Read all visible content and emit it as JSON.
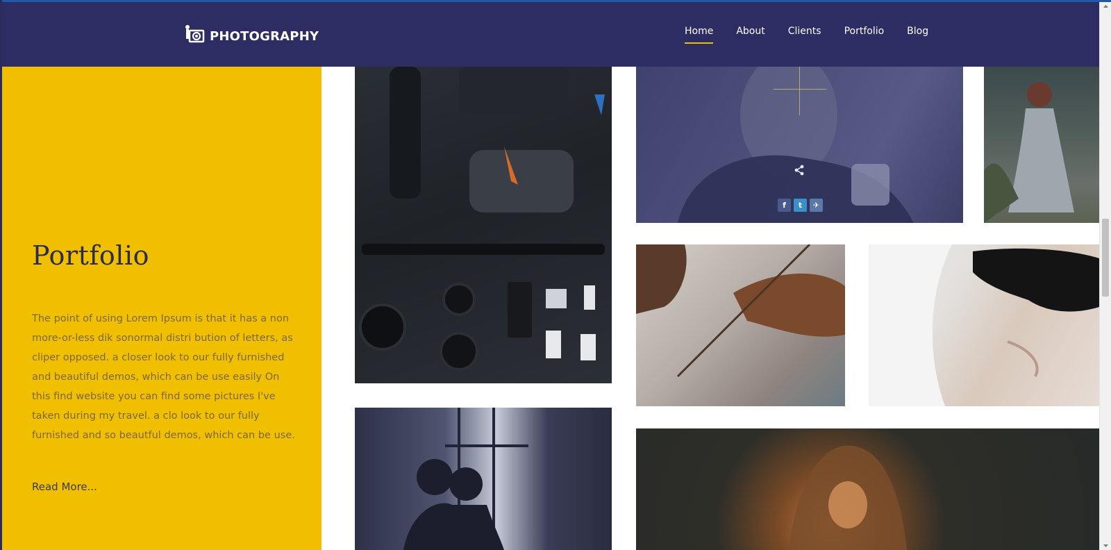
{
  "brand": {
    "name": "PHOTOGRAPHY",
    "icon": "camera-icon"
  },
  "nav": {
    "items": [
      {
        "label": "Home",
        "active": true
      },
      {
        "label": "About",
        "active": false
      },
      {
        "label": "Clients",
        "active": false
      },
      {
        "label": "Portfolio",
        "active": false
      },
      {
        "label": "Blog",
        "active": false
      }
    ]
  },
  "portfolio": {
    "title": "Portfolio",
    "description": "The point of using Lorem Ipsum is that it has a non more-or-less dik sonormal distri bution of letters, as cliper opposed. a closer look to our fully furnished and beautiful demos, which can be use easily On this find website you can find some pictures I've taken during my travel. a clo look to our fully furnished and so beautful demos, which can be use.",
    "read_more": "Read More..."
  },
  "share": {
    "icon": "share-icon",
    "buttons": [
      {
        "label": "f",
        "icon": "facebook-icon"
      },
      {
        "label": "t",
        "icon": "twitter-icon"
      },
      {
        "label": "✈",
        "icon": "telegram-icon"
      }
    ]
  },
  "colors": {
    "navbar": "#2d2c63",
    "accent": "#f0c000",
    "panel_text": "#7d6640",
    "title_text": "#2d2c4a"
  }
}
